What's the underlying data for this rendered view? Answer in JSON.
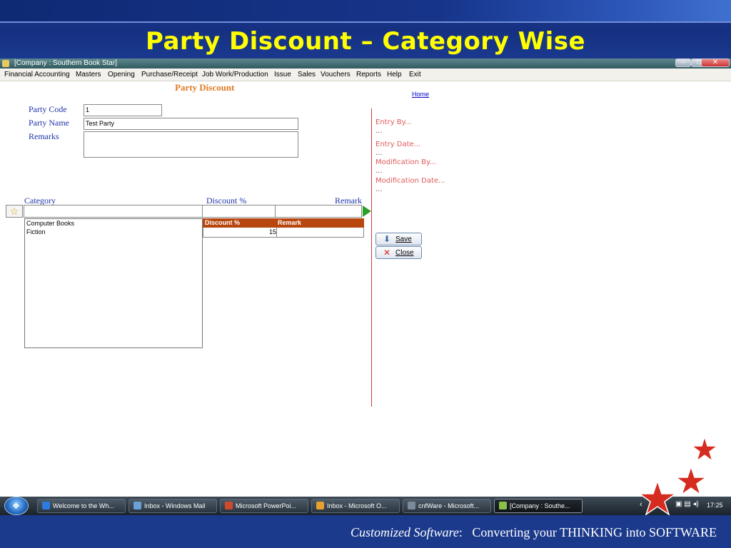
{
  "slide": {
    "title": "Party Discount – Category Wise",
    "footer_italic": "Customized Software",
    "footer_colon": ":",
    "footer_rest": "Converting your THINKING into SOFTWARE"
  },
  "window": {
    "title": "[Company : Southern Book Star]"
  },
  "menu": [
    "Financial Accounting",
    "Masters",
    "Opening",
    "Purchase/Receipt",
    "Job Work/Production",
    "Issue",
    "Sales",
    "Vouchers",
    "Reports",
    "Help",
    "Exit"
  ],
  "form": {
    "title": "Party Discount",
    "home_link": "Home",
    "party_code_label": "Party Code",
    "party_code_value": "1",
    "party_name_label": "Party Name",
    "party_name_value": "Test Party",
    "remarks_label": "Remarks",
    "remarks_value": ""
  },
  "audit": {
    "entry_by": "Entry  By...",
    "entry_by_value": "...",
    "entry_date": "Entry  Date...",
    "entry_date_value": "...",
    "mod_by": "Modification  By...",
    "mod_by_value": "...",
    "mod_date": "Modification  Date...",
    "mod_date_value": "..."
  },
  "grid": {
    "col_category": "Category",
    "col_discount": "Discount %",
    "col_remark": "Remark",
    "categories": [
      "Computer Books",
      "Fiction"
    ],
    "table_head_discount": "Discount %",
    "table_head_remark": "Remark",
    "rows": [
      {
        "discount": "15",
        "remark": ""
      }
    ]
  },
  "buttons": {
    "save": "Save",
    "close": "Close"
  },
  "taskbar": {
    "tasks": [
      "Welcome to the Wh...",
      "Inbox - Windows Mail",
      "Microsoft PowerPoi...",
      "Inbox - Microsoft O...",
      "cnfWare - Microsoft...",
      "[Company : Southe..."
    ],
    "clock": "17:25"
  },
  "colors": {
    "accent_title": "#ffff00",
    "table_header": "#b8470f",
    "label_blue": "#1f33aa",
    "audit_red": "#e05a5a",
    "star_red": "#d62b1f"
  }
}
